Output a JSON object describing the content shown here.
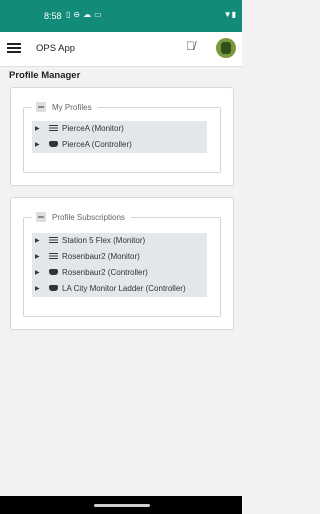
{
  "status_bar": {
    "time": "8:58",
    "icons": [
      "sim-icon",
      "sync-icon",
      "cloud-icon",
      "card-icon"
    ],
    "right_icons": [
      "wifi-icon",
      "battery-icon"
    ]
  },
  "app_bar": {
    "title": "OPS App",
    "menu_icon": "hamburger-menu-icon",
    "mic_icon": "mic-off-icon"
  },
  "page": {
    "title": "Profile Manager"
  },
  "my_profiles": {
    "legend": "My Profiles",
    "items": [
      {
        "label": "PierceA (Monitor)",
        "icon": "monitor-icon"
      },
      {
        "label": "PierceA (Controller)",
        "icon": "gamepad-icon"
      }
    ]
  },
  "subscriptions": {
    "legend": "Profile Subscriptions",
    "items": [
      {
        "label": "Station 5 Flex (Monitor)",
        "icon": "monitor-icon"
      },
      {
        "label": "Rosenbaur2 (Monitor)",
        "icon": "monitor-icon"
      },
      {
        "label": "Rosenbaur2 (Controller)",
        "icon": "gamepad-icon"
      },
      {
        "label": "LA City Monitor Ladder (Controller)",
        "icon": "gamepad-icon"
      }
    ]
  },
  "colors": {
    "status_bar": "#128b78",
    "background": "#f2f2f2",
    "list_background": "#e3e6ea"
  }
}
